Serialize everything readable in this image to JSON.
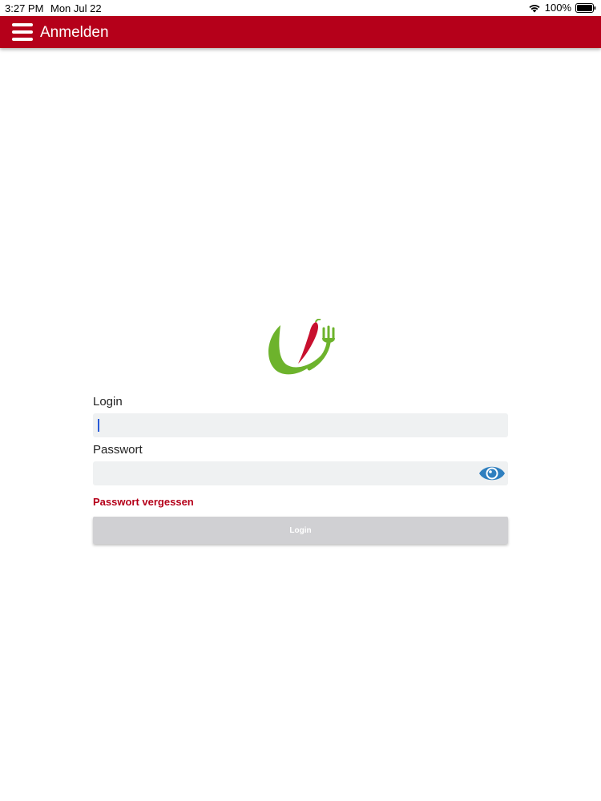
{
  "status_bar": {
    "time": "3:27 PM",
    "date": "Mon Jul 22",
    "battery": "100%",
    "wifi_icon": "wifi-icon",
    "battery_icon": "battery-icon"
  },
  "app_bar": {
    "title": "Anmelden",
    "menu_icon": "hamburger-menu-icon",
    "color": "#b5001a"
  },
  "logo": {
    "icon": "leaf-chili-fork-logo",
    "colors": [
      "#6db32c",
      "#c8102e"
    ]
  },
  "form": {
    "login_label": "Login",
    "login_value": "",
    "password_label": "Passwort",
    "password_value": "",
    "password_toggle_icon": "eye-icon",
    "forgot_password": "Passwort vergessen",
    "submit_label": "Login"
  }
}
